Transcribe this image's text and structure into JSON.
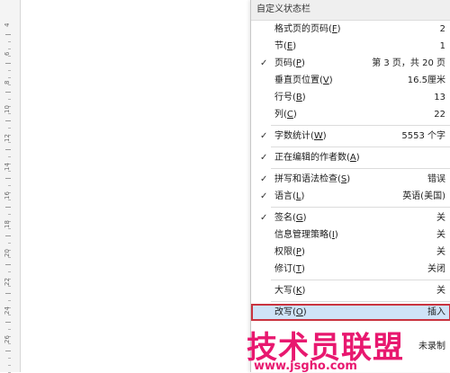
{
  "ruler": {
    "numbers": [
      "4",
      "6",
      "8",
      "10",
      "12",
      "14",
      "16",
      "18",
      "20",
      "22",
      "24",
      "26"
    ]
  },
  "menu": {
    "title": "自定义状态栏",
    "items": [
      {
        "label": "格式页的页码",
        "key": "F",
        "value": "2",
        "checked": false
      },
      {
        "label": "节",
        "key": "E",
        "value": "1",
        "checked": false
      },
      {
        "label": "页码",
        "key": "P",
        "value": "第 3 页，共 20 页",
        "checked": true
      },
      {
        "label": "垂直页位置",
        "key": "V",
        "value": "16.5厘米",
        "checked": false
      },
      {
        "label": "行号",
        "key": "B",
        "value": "13",
        "checked": false
      },
      {
        "label": "列",
        "key": "C",
        "value": "22",
        "checked": false
      },
      {
        "label": "字数统计",
        "key": "W",
        "value": "5553 个字",
        "checked": true
      },
      {
        "label": "正在编辑的作者数",
        "key": "A",
        "value": "",
        "checked": true
      },
      {
        "label": "拼写和语法检查",
        "key": "S",
        "value": "错误",
        "checked": true
      },
      {
        "label": "语言",
        "key": "L",
        "value": "英语(美国)",
        "checked": true
      },
      {
        "label": "签名",
        "key": "G",
        "value": "关",
        "checked": true
      },
      {
        "label": "信息管理策略",
        "key": "I",
        "value": "关",
        "checked": false
      },
      {
        "label": "权限",
        "key": "P",
        "value": "关",
        "checked": false
      },
      {
        "label": "修订",
        "key": "T",
        "value": "关闭",
        "checked": false
      },
      {
        "label": "大写",
        "key": "K",
        "value": "关",
        "checked": false
      },
      {
        "label": "改写",
        "key": "O",
        "value": "插入",
        "checked": false
      },
      {
        "label": "",
        "key": "",
        "value": "",
        "checked": false
      },
      {
        "label": "",
        "key": "",
        "value": "未录制",
        "checked": false
      },
      {
        "label": "",
        "key": "",
        "value": "",
        "checked": false
      }
    ]
  },
  "watermark": {
    "title": "技术员联盟",
    "url": "www.jsgho.com"
  }
}
